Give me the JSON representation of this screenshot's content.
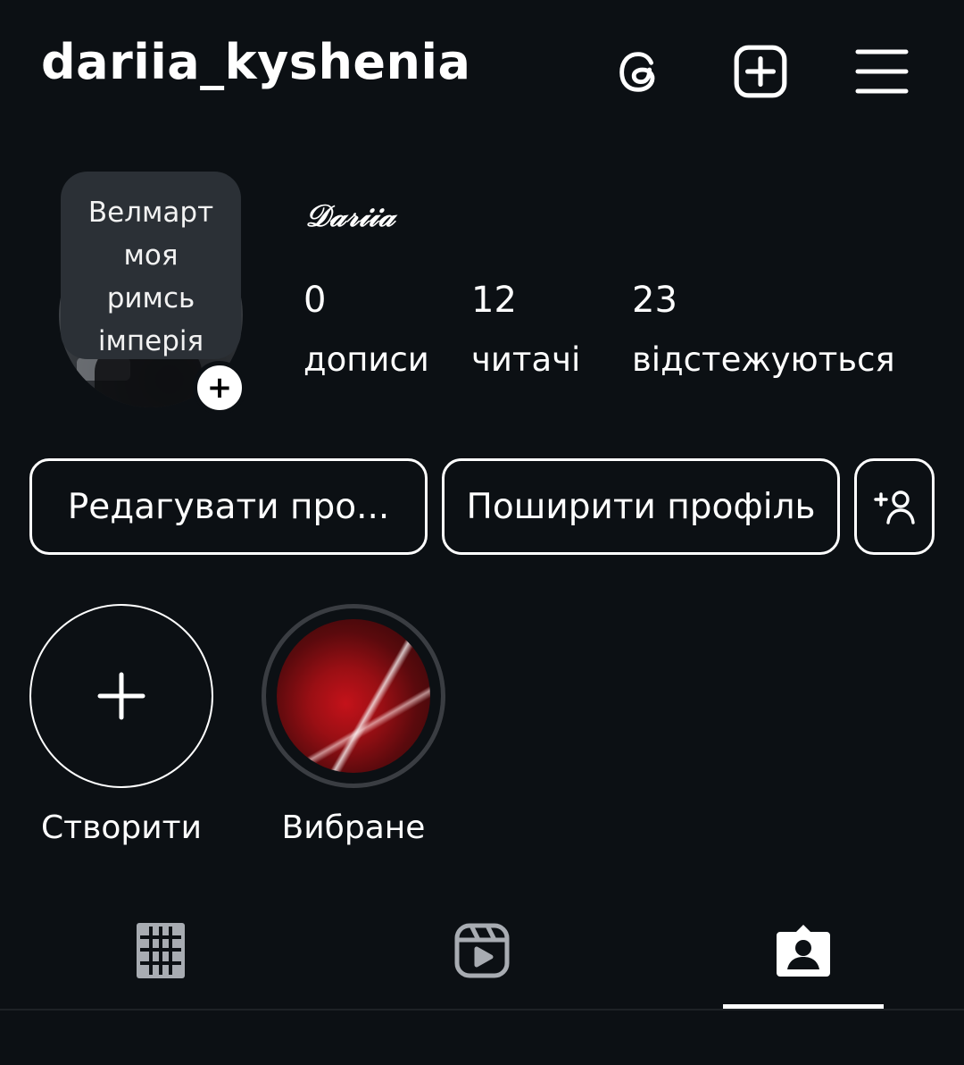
{
  "header": {
    "username": "dariia_kyshenia",
    "icons": [
      "threads-icon",
      "create-plus-icon",
      "menu-icon"
    ]
  },
  "profile": {
    "note_lines": [
      "Велмарт",
      "моя",
      "римсь",
      "імперія"
    ],
    "display_name": "𝒟𝒶𝓇𝒾𝒾𝒶",
    "stats": {
      "posts": {
        "value": "0",
        "label": "дописи"
      },
      "followers": {
        "value": "12",
        "label": "читачі"
      },
      "following": {
        "value": "23",
        "label": "відстежуються"
      }
    }
  },
  "actions": {
    "edit_profile": "Редагувати про...",
    "share_profile": "Поширити профіль",
    "discover_people_icon": "add-person-icon"
  },
  "highlights": [
    {
      "label": "Створити",
      "icon": "plus-icon"
    },
    {
      "label": "Вибране"
    }
  ],
  "tabs": {
    "items": [
      "grid-icon",
      "reels-icon",
      "tagged-icon"
    ],
    "active": "tagged-icon"
  },
  "colors": {
    "background": "#0c1014",
    "foreground": "#ffffff",
    "inactive_icon": "#a8acb2"
  }
}
